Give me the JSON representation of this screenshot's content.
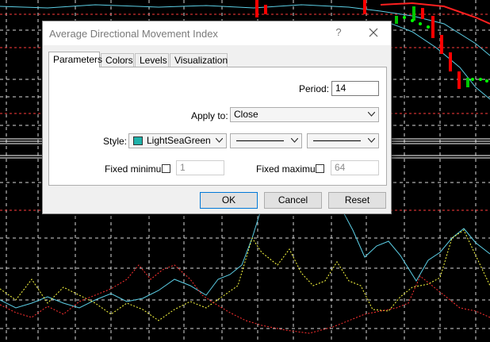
{
  "dialog": {
    "title": "Average Directional Movement Index",
    "help_glyph": "?"
  },
  "tabs": [
    {
      "label": "Parameters",
      "active": true
    },
    {
      "label": "Colors",
      "active": false
    },
    {
      "label": "Levels",
      "active": false
    },
    {
      "label": "Visualization",
      "active": false
    }
  ],
  "params": {
    "period_label": "Period:",
    "period_value": "14",
    "apply_label": "Apply to:",
    "apply_value": "Close",
    "style_label": "Style:",
    "color_value": "LightSeaGreen",
    "color_hex": "#20b2aa",
    "fixed_min_label": "Fixed minimum",
    "fixed_min_value": "1",
    "fixed_min_checked": false,
    "fixed_max_label": "Fixed maximum",
    "fixed_max_value": "64",
    "fixed_max_checked": false
  },
  "buttons": {
    "ok": "OK",
    "cancel": "Cancel",
    "reset": "Reset"
  },
  "colors": {
    "chart_bg": "#000000",
    "grid": "#ffffff",
    "bull_candle": "#00c800",
    "bear_candle": "#ff0000",
    "adx_line": "#20b2aa",
    "plus_di": "#ffff00",
    "minus_di": "#ff0000"
  }
}
